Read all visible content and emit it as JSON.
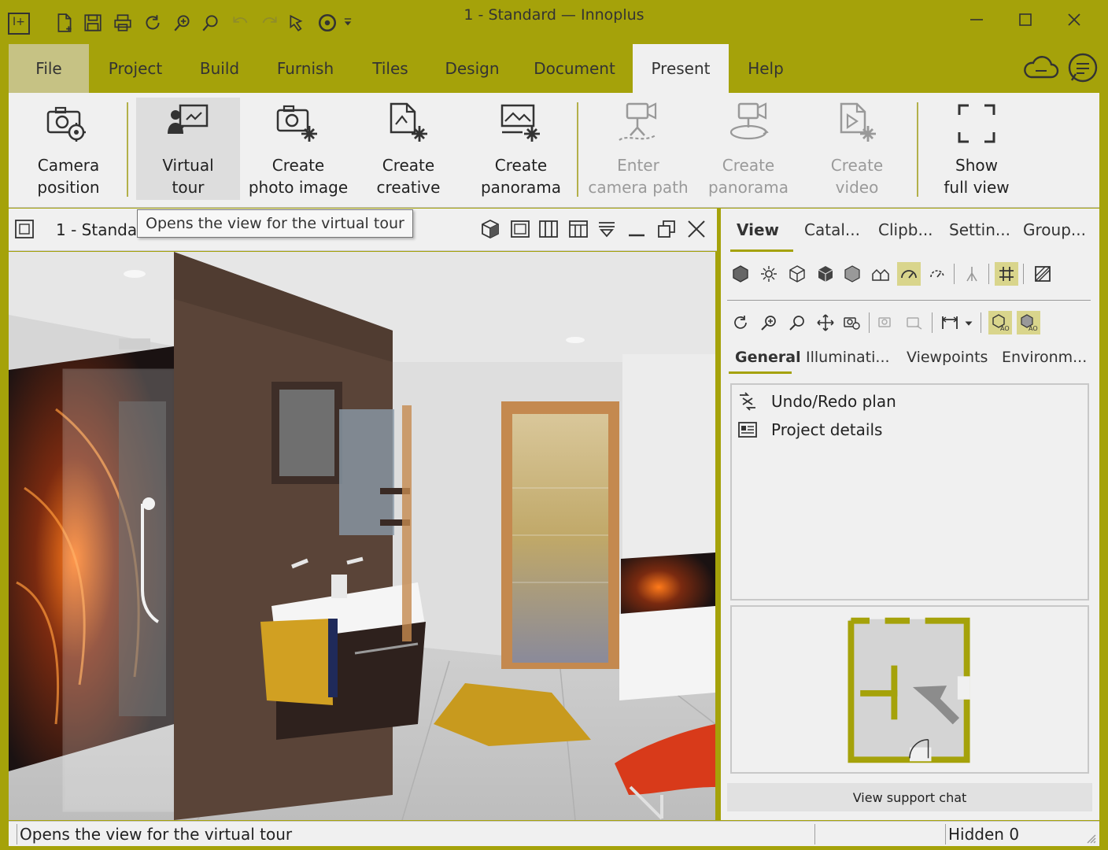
{
  "window": {
    "title": "1 - Standard — Innoplus"
  },
  "menu": {
    "tabs": [
      {
        "label": "File"
      },
      {
        "label": "Project"
      },
      {
        "label": "Build"
      },
      {
        "label": "Furnish"
      },
      {
        "label": "Tiles"
      },
      {
        "label": "Design"
      },
      {
        "label": "Document"
      },
      {
        "label": "Present"
      },
      {
        "label": "Help"
      }
    ],
    "active_tab": "Present"
  },
  "ribbon": {
    "buttons": [
      {
        "label": "Camera\nposition",
        "icon": "camera-settings-icon",
        "enabled": true
      },
      {
        "label": "Virtual\ntour",
        "icon": "virtual-tour-icon",
        "enabled": true
      },
      {
        "label": "Create\nphoto image",
        "icon": "photo-create-icon",
        "enabled": true
      },
      {
        "label": "Create\ncreative",
        "icon": "creative-create-icon",
        "enabled": true
      },
      {
        "label": "Create\npanorama",
        "icon": "panorama-create-icon",
        "enabled": true
      },
      {
        "label": "Enter\ncamera path",
        "icon": "camera-path-icon",
        "enabled": false
      },
      {
        "label": "Create\npanorama",
        "icon": "panorama-camera-icon",
        "enabled": false
      },
      {
        "label": "Create\nvideo",
        "icon": "video-create-icon",
        "enabled": false
      },
      {
        "label": "Show\nfull view",
        "icon": "full-view-icon",
        "enabled": true
      }
    ]
  },
  "tooltip": {
    "text": "Opens the view for the virtual tour"
  },
  "viewport": {
    "title": "1 - Standa"
  },
  "right_panel": {
    "tabs": [
      {
        "label": "View"
      },
      {
        "label": "Catal..."
      },
      {
        "label": "Clipb..."
      },
      {
        "label": "Settin..."
      },
      {
        "label": "Group..."
      }
    ],
    "sub_tabs": [
      {
        "label": "General"
      },
      {
        "label": "Illuminati..."
      },
      {
        "label": "Viewpoints"
      },
      {
        "label": "Environm..."
      }
    ],
    "list": [
      {
        "label": "Undo/Redo plan",
        "icon": "undo-redo-icon"
      },
      {
        "label": "Project details",
        "icon": "project-details-icon"
      }
    ],
    "support_button": "View support chat"
  },
  "status": {
    "text": "Opens the view for the virtual tour",
    "right": "Hidden 0"
  },
  "colors": {
    "accent": "#a5a20a",
    "panel": "#f0f0f0",
    "highlight": "#d9d58c"
  }
}
